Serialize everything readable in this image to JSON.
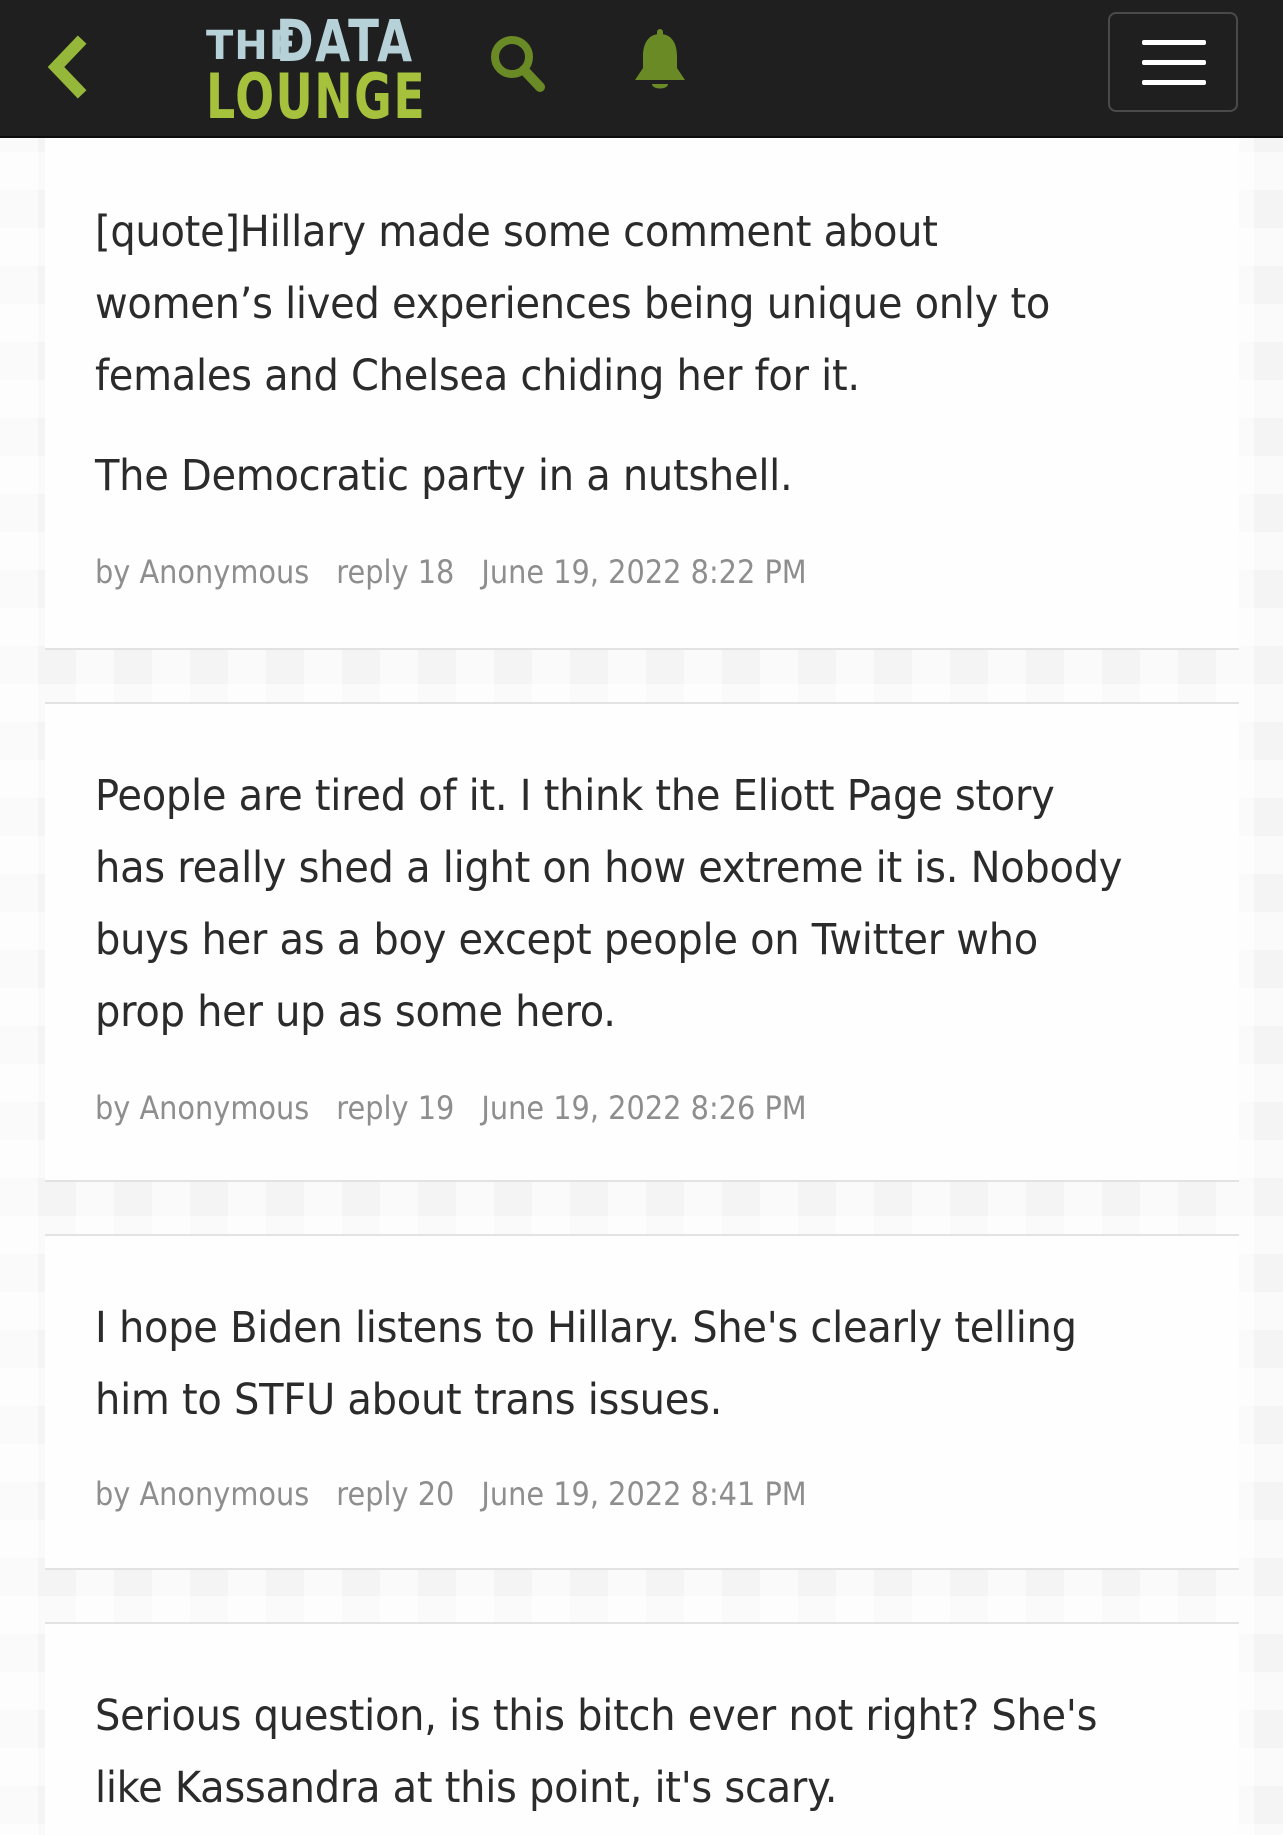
{
  "header": {
    "logo_the": "THE",
    "logo_data": "DATA",
    "logo_lounge": "LOUNGE"
  },
  "icons": {
    "back": "chevron-left-icon",
    "search": "search-icon",
    "notifications": "bell-icon",
    "menu": "hamburger-menu-icon"
  },
  "colors": {
    "header_bg": "#1f1f1f",
    "accent_green": "#a6c13b",
    "icon_green": "#6a8a26",
    "logo_blue": "#b7d1d8",
    "text": "#232323",
    "meta_text": "#8a8a8a"
  },
  "posts": [
    {
      "paragraphs": [
        "[quote]Hillary made some comment about women’s lived experiences being unique only to females and Chelsea chiding her for it.",
        "The Democratic party in a nutshell."
      ],
      "author": "by Anonymous",
      "reply": "reply 18",
      "timestamp": "June 19, 2022 8:22 PM"
    },
    {
      "paragraphs": [
        "People are tired of it. I think the Eliott Page story has really shed a light on how extreme it is. Nobody buys her as a boy except people on Twitter who prop her up as some hero."
      ],
      "author": "by Anonymous",
      "reply": "reply 19",
      "timestamp": "June 19, 2022 8:26 PM"
    },
    {
      "paragraphs": [
        "I hope Biden listens to Hillary. She's clearly telling him to STFU about trans issues."
      ],
      "author": "by Anonymous",
      "reply": "reply 20",
      "timestamp": "June 19, 2022 8:41 PM"
    },
    {
      "paragraphs": [
        "Serious question, is this bitch ever not right? She's like Kassandra at this point, it's scary."
      ]
    }
  ]
}
